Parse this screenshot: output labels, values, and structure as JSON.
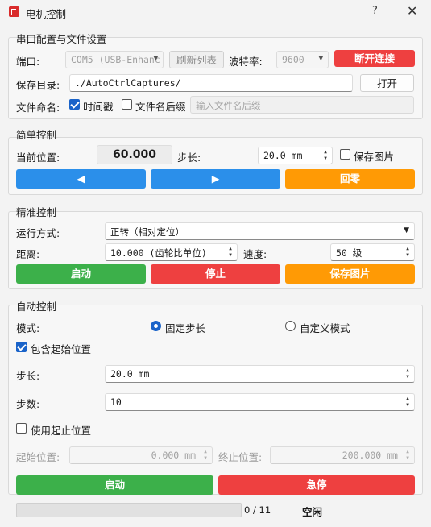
{
  "window": {
    "title": "电机控制",
    "help_label": "?",
    "close_label": "✕"
  },
  "serial": {
    "group_title": "串口配置与文件设置",
    "port_label": "端口:",
    "port_value": "COM5 (USB-Enhanc",
    "refresh_label": "刷新列表",
    "baud_label": "波特率:",
    "baud_value": "9600",
    "disconnect_label": "断开连接",
    "save_dir_label": "保存目录:",
    "save_dir_value": "./AutoCtrlCaptures/",
    "open_label": "打开",
    "file_name_label": "文件命名:",
    "timestamp_label": "时间戳",
    "timestamp_checked": true,
    "suffix_label": "文件名后缀",
    "suffix_checked": false,
    "suffix_placeholder": "输入文件名后缀"
  },
  "simple": {
    "group_title": "简单控制",
    "position_label": "当前位置:",
    "position_value": "60.000",
    "step_label": "步长:",
    "step_value": "20.0 mm",
    "save_image_label": "保存图片",
    "save_image_checked": false,
    "left_label": "◀",
    "right_label": "▶",
    "home_label": "回零"
  },
  "precise": {
    "group_title": "精准控制",
    "mode_label": "运行方式:",
    "mode_value": "正转（相对定位）",
    "distance_label": "距离:",
    "distance_value": "10.000 (齿轮比单位)",
    "speed_label": "速度:",
    "speed_value": "50 级",
    "start_label": "启动",
    "stop_label": "停止",
    "save_image_label": "保存图片"
  },
  "auto": {
    "group_title": "自动控制",
    "mode_label": "模式:",
    "fixed_step_label": "固定步长",
    "fixed_step_selected": true,
    "custom_mode_label": "自定义模式",
    "include_start_label": "包含起始位置",
    "include_start_checked": true,
    "step_label": "步长:",
    "step_value": "20.0 mm",
    "steps_label": "步数:",
    "steps_value": "10",
    "use_range_label": "使用起止位置",
    "use_range_checked": false,
    "start_pos_label": "起始位置:",
    "start_pos_value": "0.000 mm",
    "end_pos_label": "终止位置:",
    "end_pos_value": "200.000 mm",
    "start_label": "启动",
    "emergency_label": "急停",
    "progress_text": "0 / 11",
    "progress_fraction": 0,
    "status_label": "空闲"
  },
  "colors": {
    "red": "#ee4040",
    "blue": "#2b8fea",
    "orange": "#ff9a05",
    "green": "#3cb04a",
    "accent": "#1a63c9"
  }
}
